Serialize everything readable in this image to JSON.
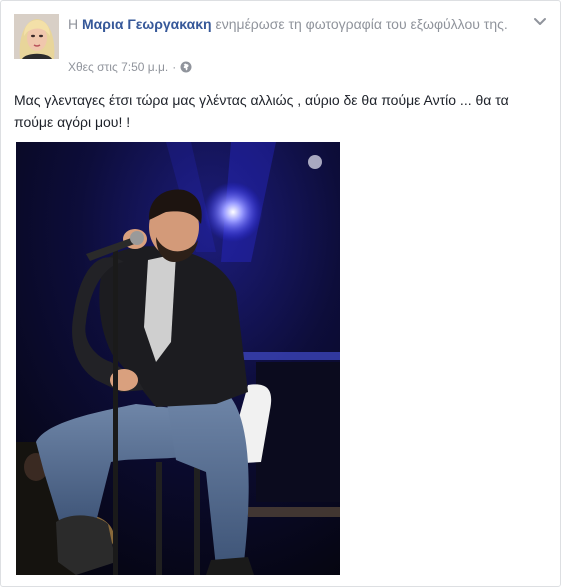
{
  "post": {
    "prefix": "Η",
    "author": "Μαρια Γεωργακακη",
    "action": "ενημέρωσε τη φωτογραφία του εξωφύλλου της.",
    "timestamp": "Χθες στις 7:50 μ.μ.",
    "separator": "·",
    "audience_icon": "globe-icon",
    "menu_icon": "chevron-down-icon",
    "text": "Μας γλενταγες έτσι τώρα μας γλέντας αλλιώς , αύριο δε θα πούμε Αντίο ... θα τα πούμε αγόρι μου! !"
  },
  "colors": {
    "author_link": "#365899",
    "meta_text": "#90949c",
    "body_text": "#1d2129",
    "photo_background": "#0a0a1a",
    "stage_light": "#3b3bff"
  }
}
